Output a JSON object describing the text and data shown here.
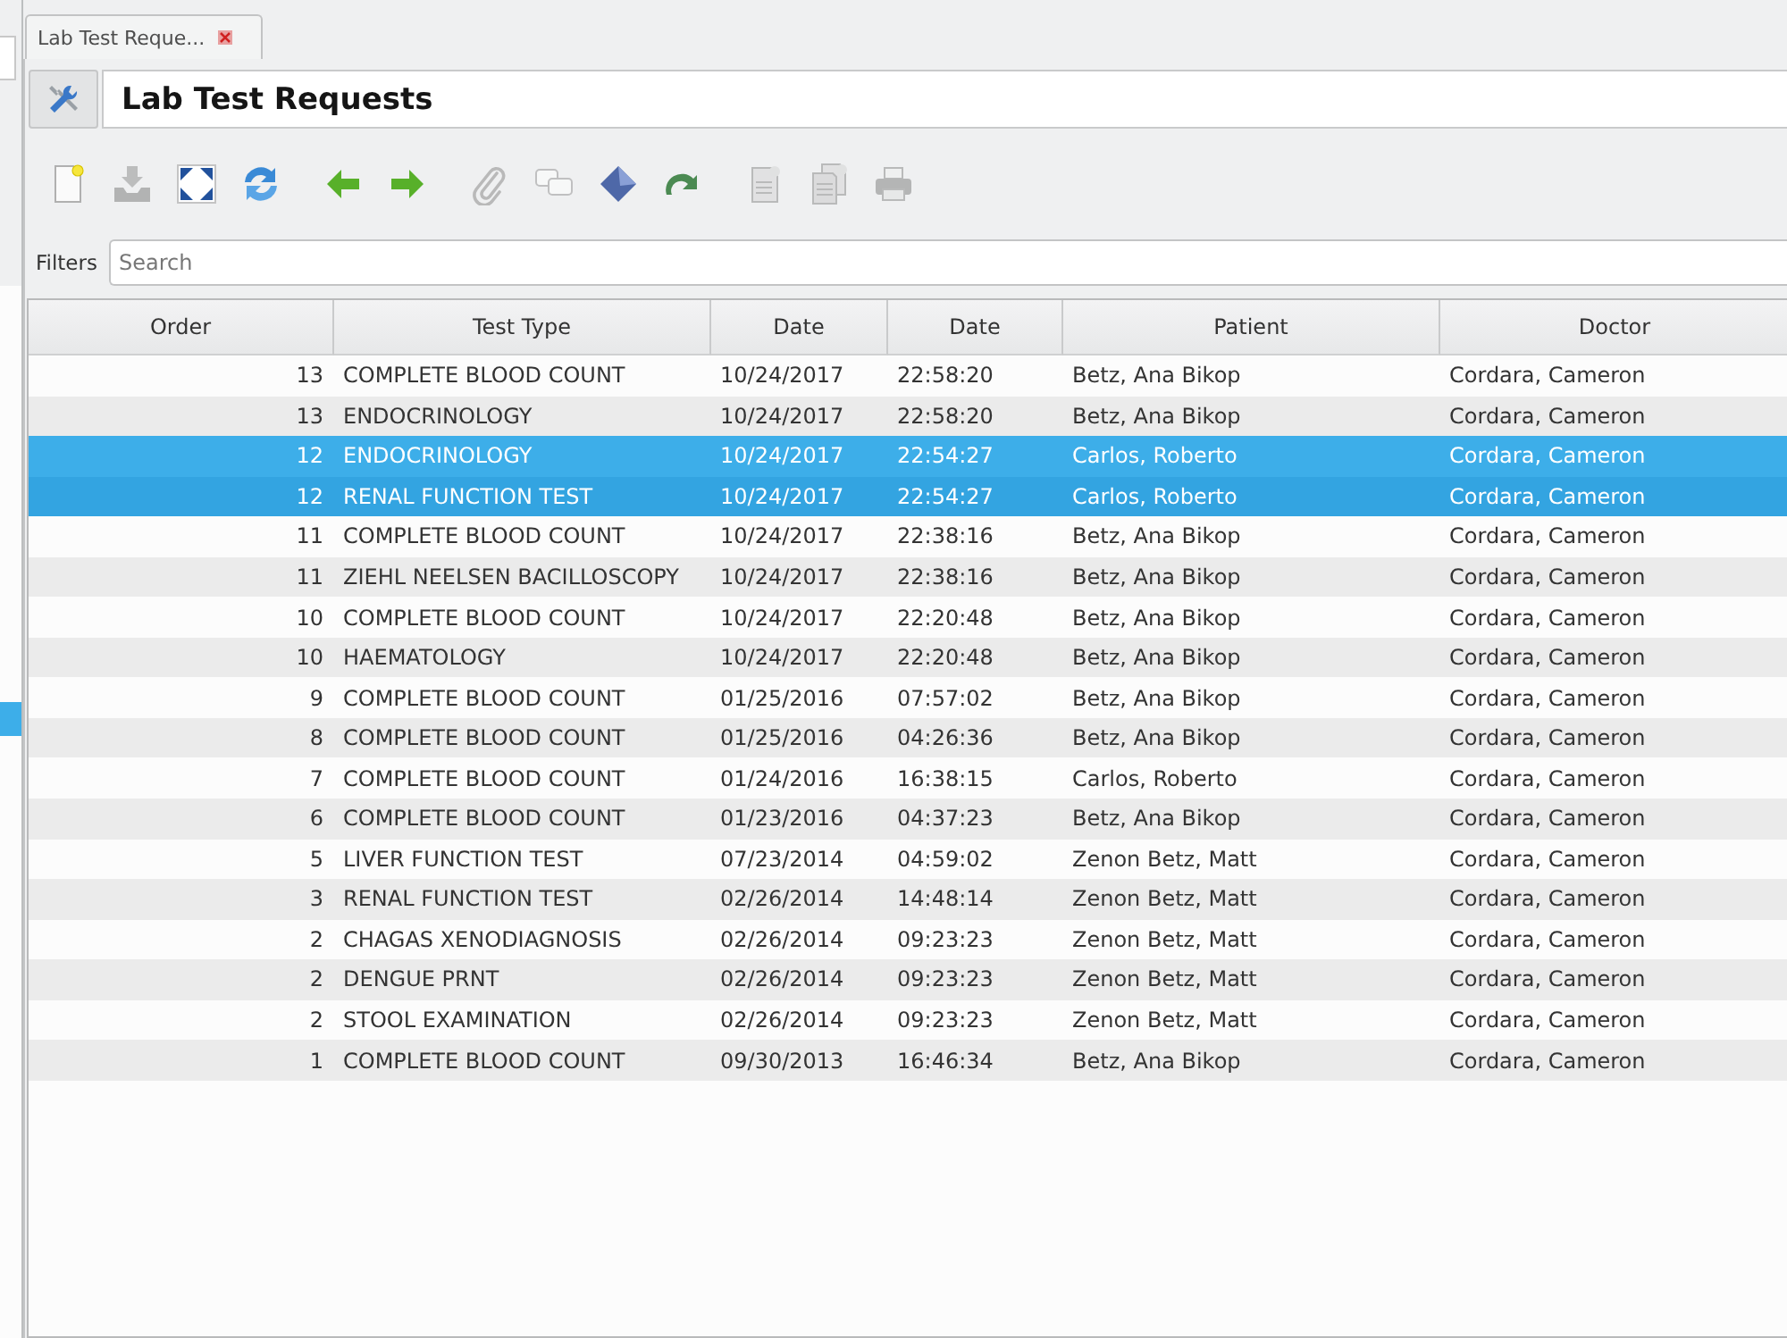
{
  "tabs": [
    {
      "label": "Lab Test Reque...",
      "selected": true
    }
  ],
  "title": "Lab Test Requests",
  "toolbar": {
    "groups": [
      {
        "buttons": [
          {
            "kind": "new",
            "disabled": false
          },
          {
            "kind": "save",
            "disabled": true
          },
          {
            "kind": "expand",
            "disabled": false
          },
          {
            "kind": "refresh",
            "disabled": false
          }
        ]
      },
      {
        "buttons": [
          {
            "kind": "back",
            "disabled": false
          },
          {
            "kind": "forward",
            "disabled": false
          }
        ]
      },
      {
        "buttons": [
          {
            "kind": "attach",
            "disabled": true
          },
          {
            "kind": "chat",
            "disabled": true
          },
          {
            "kind": "diamond",
            "disabled": false
          },
          {
            "kind": "redo",
            "disabled": false
          }
        ]
      },
      {
        "buttons": [
          {
            "kind": "report",
            "disabled": true
          },
          {
            "kind": "reports",
            "disabled": true
          },
          {
            "kind": "print",
            "disabled": true
          }
        ]
      }
    ]
  },
  "filters": {
    "label": "Filters",
    "placeholder": "Search"
  },
  "table": {
    "columns": [
      "Order",
      "Test Type",
      "Date",
      "Date",
      "Patient",
      "Doctor"
    ],
    "rows": [
      {
        "cells": [
          "13",
          "COMPLETE BLOOD COUNT",
          "10/24/2017",
          "22:58:20",
          "Betz, Ana Bikop",
          "Cordara, Cameron"
        ],
        "selected": false
      },
      {
        "cells": [
          "13",
          "ENDOCRINOLOGY",
          "10/24/2017",
          "22:58:20",
          "Betz, Ana Bikop",
          "Cordara, Cameron"
        ],
        "selected": false
      },
      {
        "cells": [
          "12",
          "ENDOCRINOLOGY",
          "10/24/2017",
          "22:54:27",
          "Carlos, Roberto",
          "Cordara, Cameron"
        ],
        "selected": true
      },
      {
        "cells": [
          "12",
          "RENAL FUNCTION TEST",
          "10/24/2017",
          "22:54:27",
          "Carlos, Roberto",
          "Cordara, Cameron"
        ],
        "selected": true
      },
      {
        "cells": [
          "11",
          "COMPLETE BLOOD COUNT",
          "10/24/2017",
          "22:38:16",
          "Betz, Ana Bikop",
          "Cordara, Cameron"
        ],
        "selected": false
      },
      {
        "cells": [
          "11",
          "ZIEHL NEELSEN BACILLOSCOPY",
          "10/24/2017",
          "22:38:16",
          "Betz, Ana Bikop",
          "Cordara, Cameron"
        ],
        "selected": false
      },
      {
        "cells": [
          "10",
          "COMPLETE BLOOD COUNT",
          "10/24/2017",
          "22:20:48",
          "Betz, Ana Bikop",
          "Cordara, Cameron"
        ],
        "selected": false
      },
      {
        "cells": [
          "10",
          "HAEMATOLOGY",
          "10/24/2017",
          "22:20:48",
          "Betz, Ana Bikop",
          "Cordara, Cameron"
        ],
        "selected": false
      },
      {
        "cells": [
          "9",
          "COMPLETE BLOOD COUNT",
          "01/25/2016",
          "07:57:02",
          "Betz, Ana Bikop",
          "Cordara, Cameron"
        ],
        "selected": false
      },
      {
        "cells": [
          "8",
          "COMPLETE BLOOD COUNT",
          "01/25/2016",
          "04:26:36",
          "Betz, Ana Bikop",
          "Cordara, Cameron"
        ],
        "selected": false
      },
      {
        "cells": [
          "7",
          "COMPLETE BLOOD COUNT",
          "01/24/2016",
          "16:38:15",
          "Carlos, Roberto",
          "Cordara, Cameron"
        ],
        "selected": false
      },
      {
        "cells": [
          "6",
          "COMPLETE BLOOD COUNT",
          "01/23/2016",
          "04:37:23",
          "Betz, Ana Bikop",
          "Cordara, Cameron"
        ],
        "selected": false
      },
      {
        "cells": [
          "5",
          "LIVER FUNCTION TEST",
          "07/23/2014",
          "04:59:02",
          "Zenon Betz, Matt",
          "Cordara, Cameron"
        ],
        "selected": false
      },
      {
        "cells": [
          "3",
          "RENAL FUNCTION TEST",
          "02/26/2014",
          "14:48:14",
          "Zenon Betz, Matt",
          "Cordara, Cameron"
        ],
        "selected": false
      },
      {
        "cells": [
          "2",
          "CHAGAS XENODIAGNOSIS",
          "02/26/2014",
          "09:23:23",
          "Zenon Betz, Matt",
          "Cordara, Cameron"
        ],
        "selected": false
      },
      {
        "cells": [
          "2",
          "DENGUE PRNT",
          "02/26/2014",
          "09:23:23",
          "Zenon Betz, Matt",
          "Cordara, Cameron"
        ],
        "selected": false
      },
      {
        "cells": [
          "2",
          "STOOL EXAMINATION",
          "02/26/2014",
          "09:23:23",
          "Zenon Betz, Matt",
          "Cordara, Cameron"
        ],
        "selected": false
      },
      {
        "cells": [
          "1",
          "COMPLETE BLOOD COUNT",
          "09/30/2013",
          "16:46:34",
          "Betz, Ana Bikop",
          "Cordara, Cameron"
        ],
        "selected": false
      }
    ]
  }
}
